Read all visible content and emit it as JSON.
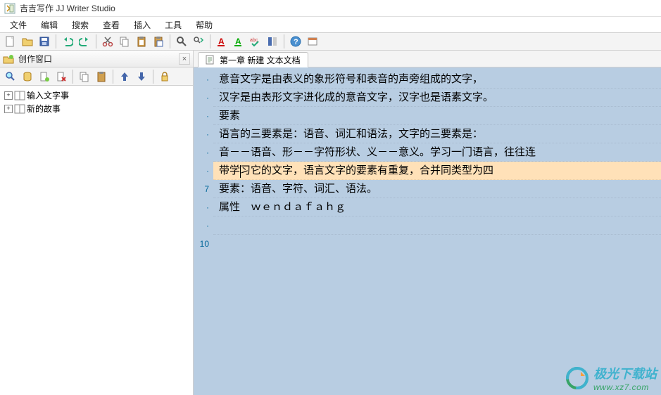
{
  "app": {
    "title": "吉吉写作 JJ Writer Studio"
  },
  "menu": {
    "items": [
      "文件",
      "编辑",
      "搜索",
      "查看",
      "插入",
      "工具",
      "帮助"
    ]
  },
  "toolbar_icons": [
    "new-icon",
    "open-icon",
    "save-icon",
    "sep",
    "undo-icon",
    "redo-icon",
    "sep",
    "cut-icon",
    "copy-icon",
    "paste-icon",
    "paste2-icon",
    "sep",
    "find-icon",
    "replace-icon",
    "sep",
    "a-red-icon",
    "a-green-icon",
    "abc-icon",
    "toggle-icon",
    "sep",
    "help-icon",
    "window-icon"
  ],
  "sidebar": {
    "panel_title": "创作窗口",
    "toolbar_icons": [
      "find-blue-icon",
      "db-icon",
      "attach-icon",
      "delete-icon",
      "sep",
      "copy-icon",
      "paste-icon",
      "sep",
      "up-icon",
      "down-icon",
      "sep",
      "lock-icon"
    ],
    "tree": [
      {
        "toggle": "+",
        "label": "输入文字事"
      },
      {
        "toggle": "+",
        "label": "新的故事"
      }
    ]
  },
  "tab": {
    "label": "第一章 新建 文本文档"
  },
  "editor": {
    "gutter": [
      "·",
      "·",
      "·",
      "·",
      "·",
      "·",
      "7",
      "·",
      "·",
      "10"
    ],
    "lines": [
      "意音文字是由表义的象形符号和表音的声旁组成的文字，",
      "汉字是由表形文字进化成的意音文字，汉字也是语素文字。",
      "要素",
      "语言的三要素是：语音、词汇和语法，文字的三要素是：",
      "音－－语音、形－－字符形状、义－－意义。学习一门语言，往往连",
      "带学习它的文字，语言文字的要素有重复，合并同类型为四",
      "要素：语音、字符、词汇、语法。",
      "属性　ｗｅｎｄａｆａｈｇ",
      ""
    ],
    "current_line_index": 5,
    "caret_after_chars": 2
  },
  "watermark": {
    "text": "极光下载站",
    "url": "www.xz7.com"
  }
}
